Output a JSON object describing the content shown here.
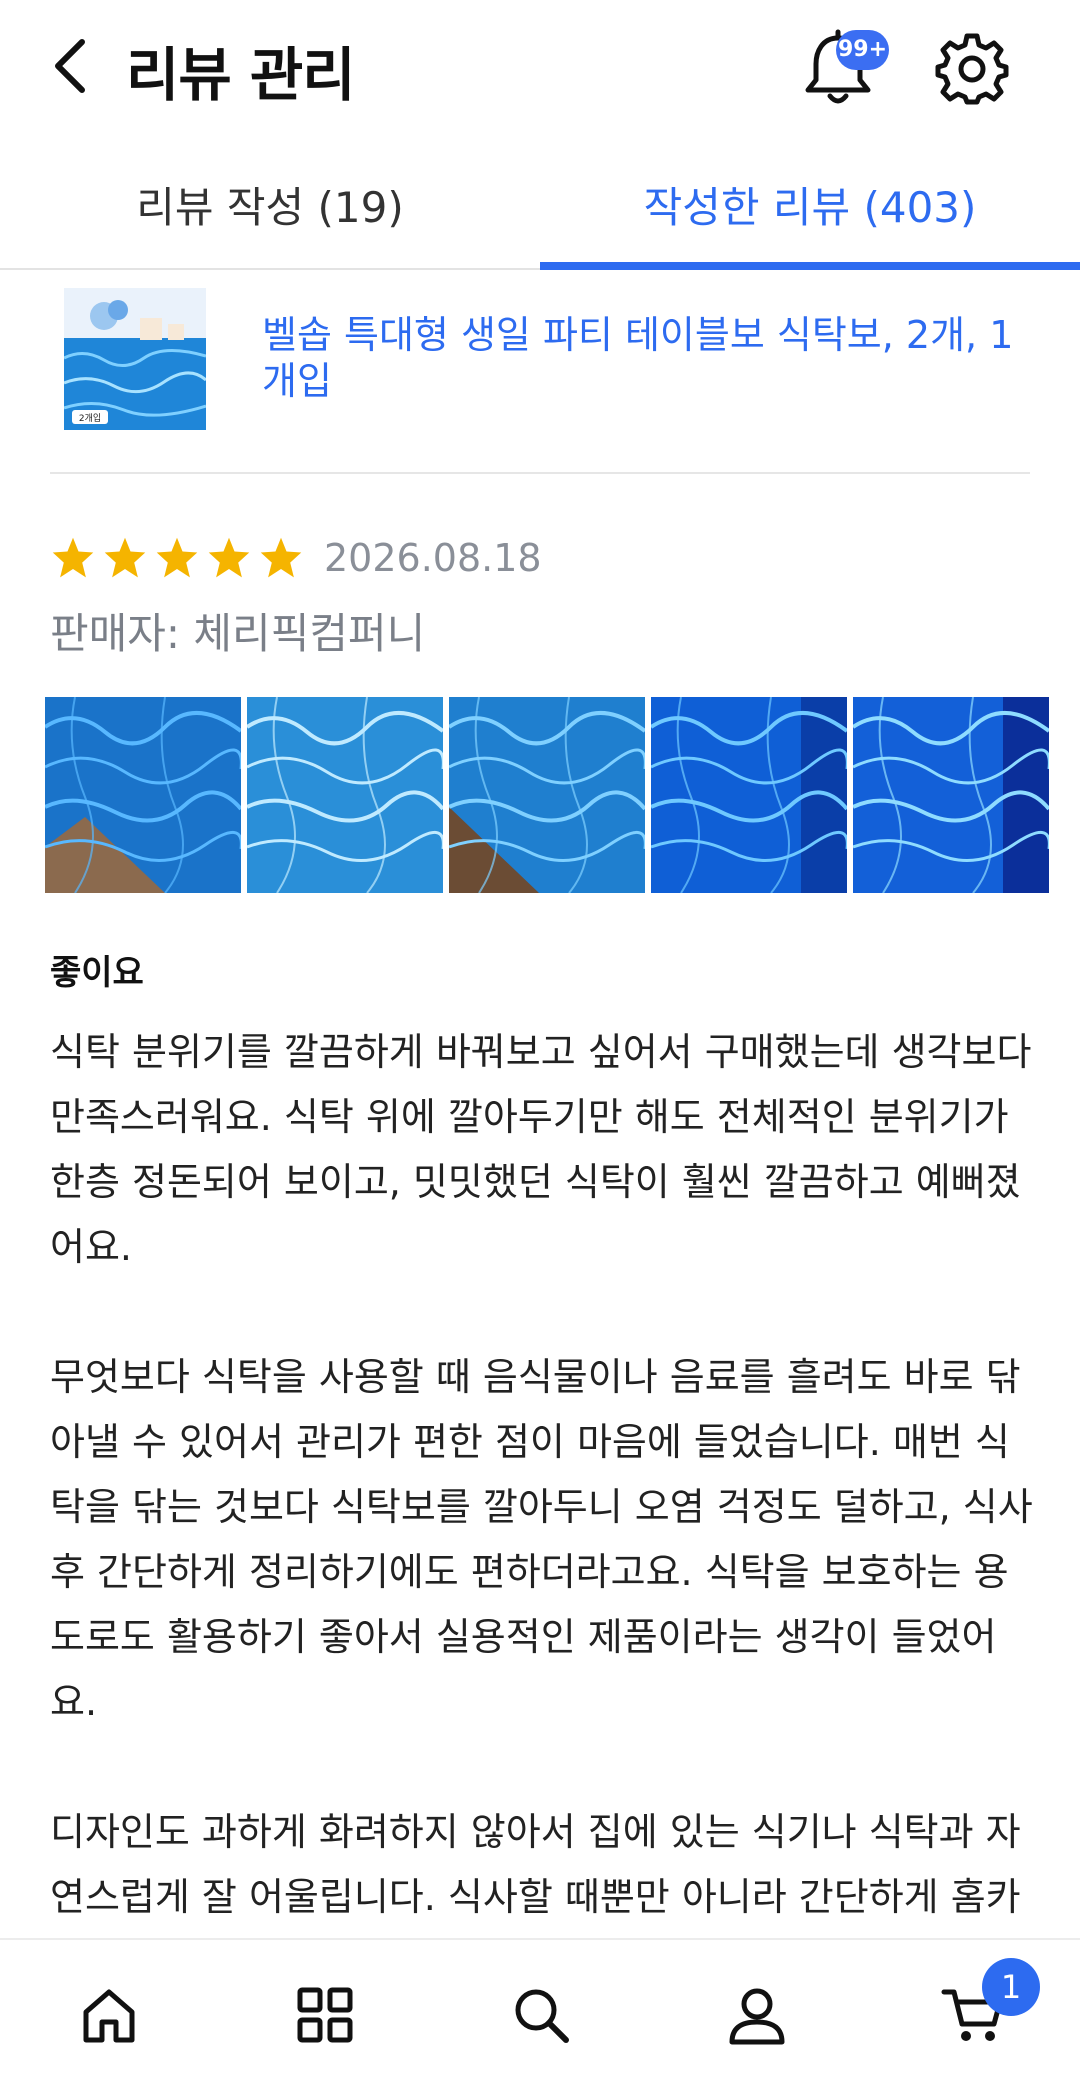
{
  "header": {
    "title": "리뷰 관리",
    "notification_count": "99+",
    "back_icon": "chevron-left-icon",
    "bell_icon": "bell-icon",
    "settings_icon": "gear-icon"
  },
  "tabs": [
    {
      "label": "리뷰 작성 (19)",
      "active": false
    },
    {
      "label": "작성한 리뷰 (403)",
      "active": true
    }
  ],
  "product": {
    "name": "벨솝 특대형 생일 파티 테이블보 식탁보, 2개, 1개입",
    "thumb_label": "2개입"
  },
  "review": {
    "rating": 5,
    "date": "2026.08.18",
    "seller_label": "판매자: 체리픽컴퍼니",
    "photo_count": 5,
    "title": "좋이요",
    "paragraphs": [
      "식탁 분위기를 깔끔하게 바꿔보고 싶어서 구매했는데 생각보다 만족스러워요. 식탁 위에 깔아두기만 해도 전체적인 분위기가 한층 정돈되어 보이고, 밋밋했던 식탁이 훨씬 깔끔하고 예뻐졌어요.",
      "무엇보다 식탁을 사용할 때 음식물이나 음료를 흘려도 바로 닦아낼 수 있어서 관리가 편한 점이 마음에 들었습니다. 매번 식탁을 닦는 것보다 식탁보를 깔아두니 오염 걱정도 덜하고, 식사 후 간단하게 정리하기에도 편하더라고요. 식탁을 보호하는 용도로도 활용하기 좋아서 실용적인 제품이라는 생각이 들었어요.",
      "디자인도 과하게 화려하지 않아서 집에 있는 식기나 식탁과 자연스럽게 잘 어울립니다. 식사할 때뿐만 아니라 간단하게 홈카페처럼 꾸미고 싶을 때 활용해도 분위기가 괜찮을 것"
    ]
  },
  "bottom_nav": {
    "items": [
      "home-icon",
      "grid-icon",
      "search-icon",
      "user-icon",
      "cart-icon"
    ],
    "cart_count": "1"
  },
  "colors": {
    "accent": "#2d6bf0",
    "star": "#f5b400",
    "muted": "#8a8f98"
  }
}
